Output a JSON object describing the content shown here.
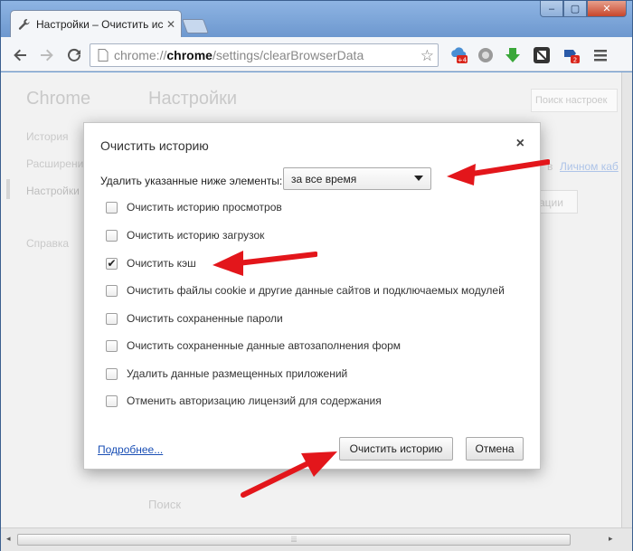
{
  "window": {
    "tab_title": "Настройки – Очистить ис",
    "controls": [
      "–",
      "▢",
      "✕"
    ]
  },
  "toolbar": {
    "url_prefix": "chrome://",
    "url_host": "chrome",
    "url_path": "/settings/clearBrowserData",
    "ext_badges": [
      "+4",
      "2"
    ]
  },
  "background": {
    "brand": "Chrome",
    "page_title": "Настройки",
    "search_placeholder": "Поиск настроек",
    "nav": [
      "История",
      "Расширения",
      "Настройки",
      "Справка"
    ],
    "side_text_prefix": "в",
    "side_link": "Личном каб",
    "side_button": "ации",
    "bottom_label": "Поиск"
  },
  "dialog": {
    "title": "Очистить историю",
    "close_label": "×",
    "range_label": "Удалить указанные ниже элементы:",
    "range_value": "за все время",
    "options": [
      {
        "label": "Очистить историю просмотров",
        "checked": false
      },
      {
        "label": "Очистить историю загрузок",
        "checked": false
      },
      {
        "label": "Очистить кэш",
        "checked": true
      },
      {
        "label": "Очистить файлы cookie и другие данные сайтов и подключаемых модулей",
        "checked": false
      },
      {
        "label": "Очистить сохраненные пароли",
        "checked": false
      },
      {
        "label": "Очистить сохраненные данные автозаполнения форм",
        "checked": false
      },
      {
        "label": "Удалить данные размещенных приложений",
        "checked": false
      },
      {
        "label": "Отменить авторизацию лицензий для содержания",
        "checked": false
      }
    ],
    "more_link": "Подробнее...",
    "confirm_label": "Очистить историю",
    "cancel_label": "Отмена"
  },
  "colors": {
    "frame": "#6c9bd2",
    "link": "#1a4fb5",
    "arrow": "#e3161b"
  }
}
